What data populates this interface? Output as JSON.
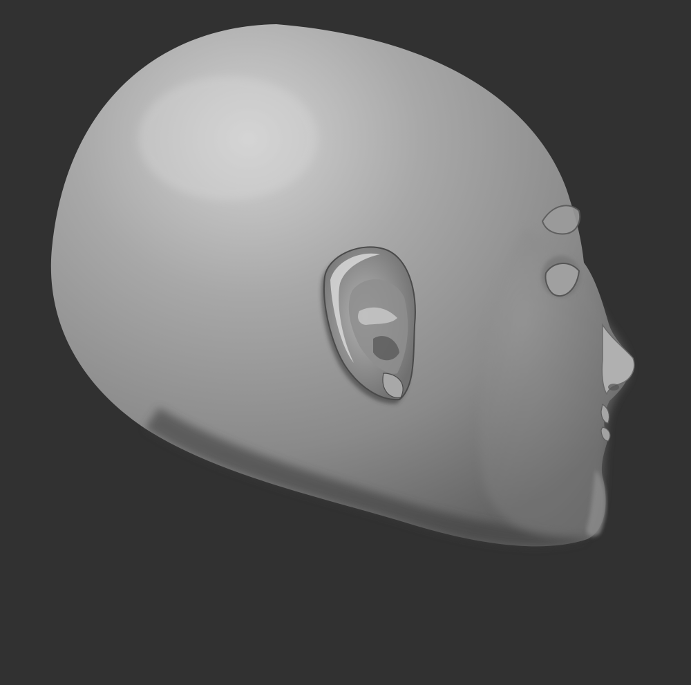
{
  "viewport": {
    "background_color": "#313131",
    "model_base_color": "#8a8a8a",
    "model_highlight_color": "#d4d4d4",
    "model_shadow_color": "#3a3a3a",
    "subject": "sculpted-bald-head-side-view"
  }
}
